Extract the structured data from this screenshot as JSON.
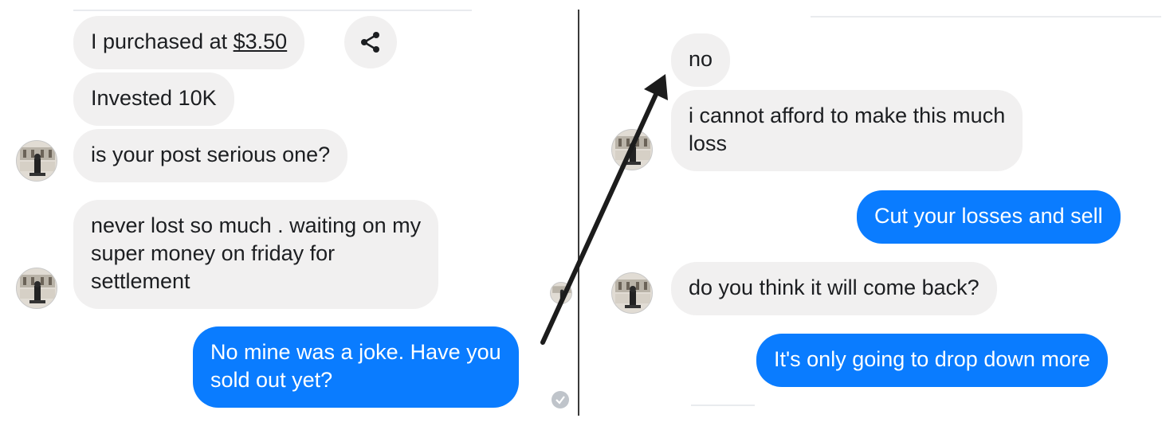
{
  "left_panel": {
    "messages": [
      {
        "text_before": "I purchased at ",
        "price": "$3.50",
        "direction": "incoming"
      },
      {
        "text": "Invested 10K",
        "direction": "incoming"
      },
      {
        "text": "is your post serious one?",
        "direction": "incoming"
      },
      {
        "lines": [
          "never lost so much . waiting on my",
          "super money on friday for",
          "settlement"
        ],
        "direction": "incoming"
      },
      {
        "lines": [
          "No mine was a joke. Have you",
          "sold out yet?"
        ],
        "direction": "outgoing"
      }
    ]
  },
  "right_panel": {
    "messages": [
      {
        "text": "no",
        "direction": "incoming"
      },
      {
        "lines": [
          "i cannot afford to make this much",
          "loss"
        ],
        "direction": "incoming"
      },
      {
        "text": "Cut your losses and sell",
        "direction": "outgoing"
      },
      {
        "text": "do you think it will come back?",
        "direction": "incoming"
      },
      {
        "text": "It's only going to drop down more",
        "direction": "outgoing"
      }
    ]
  },
  "icons": {
    "share": "share-icon",
    "avatar": "contact-avatar",
    "read_receipt": "check-icon",
    "annotation": "arrow-annotation"
  },
  "colors": {
    "outgoing_bubble": "#0a7cff",
    "incoming_bubble": "#f1f0f0",
    "arrow": "#1c1c1c"
  }
}
